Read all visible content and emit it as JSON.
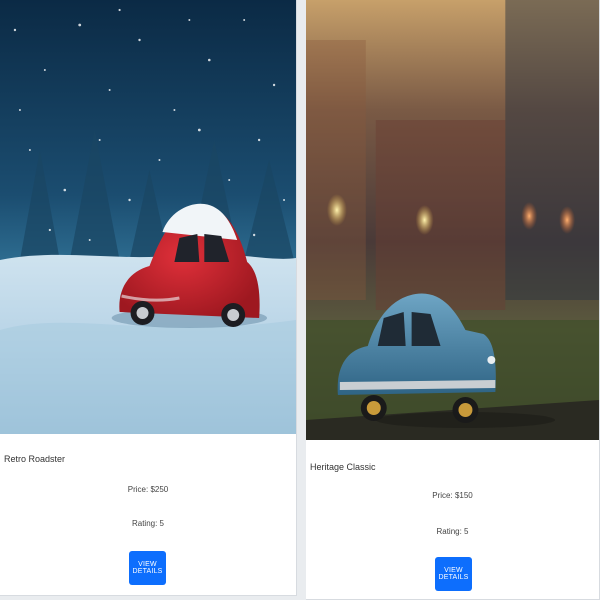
{
  "cards": [
    {
      "title": "Retro Roadster",
      "price": "Price: $250",
      "rating": "Rating: 5",
      "button_label": "VIEW DETAILS",
      "image_icon": "red-car-in-snow-photo"
    },
    {
      "title": "Heritage Classic",
      "price": "Price: $150",
      "rating": "Rating: 5",
      "button_label": "VIEW DETAILS",
      "image_icon": "blue-classic-car-photo"
    }
  ],
  "colors": {
    "button": "#0d6efd",
    "page_background": "#e9ecef"
  }
}
